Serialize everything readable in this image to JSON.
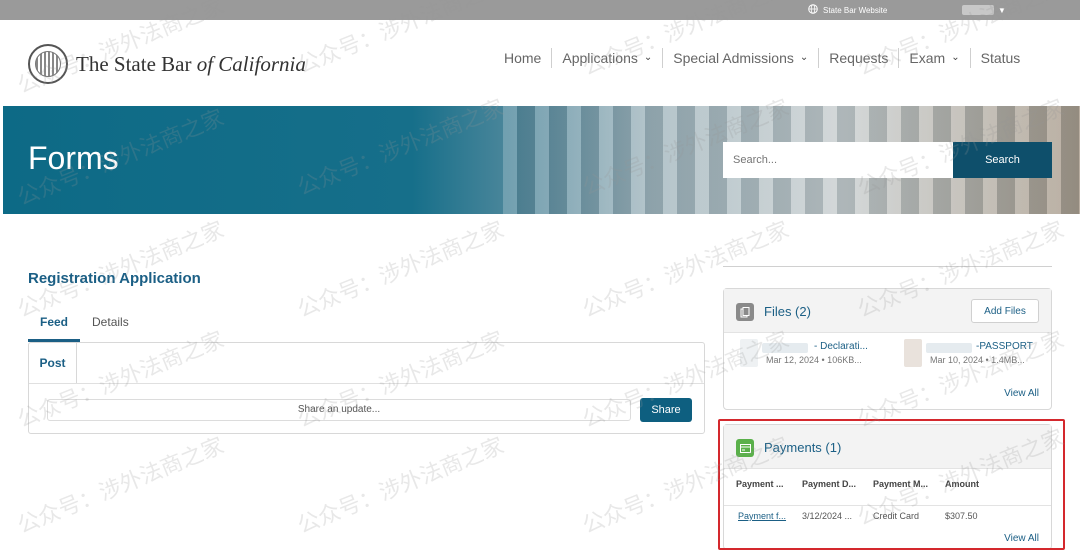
{
  "topbar": {
    "external_link": "State Bar Website"
  },
  "logo": {
    "text_main": "The State Bar",
    "text_italic": "of California"
  },
  "nav": [
    {
      "label": "Home",
      "has_menu": false
    },
    {
      "label": "Applications",
      "has_menu": true
    },
    {
      "label": "Special Admissions",
      "has_menu": true
    },
    {
      "label": "Requests",
      "has_menu": false
    },
    {
      "label": "Exam",
      "has_menu": true
    },
    {
      "label": "Status",
      "has_menu": false
    }
  ],
  "hero": {
    "title": "Forms",
    "search_placeholder": "Search...",
    "search_button": "Search"
  },
  "registration": {
    "title": "Registration Application",
    "tabs": [
      "Feed",
      "Details"
    ],
    "post_tab": "Post",
    "share_placeholder": "Share an update...",
    "share_button": "Share"
  },
  "files": {
    "title": "Files (2)",
    "add_button": "Add Files",
    "items": [
      {
        "name": "- Declarati...",
        "meta": "Mar 12, 2024 • 106KB..."
      },
      {
        "name": "-PASSPORT",
        "meta": "Mar 10, 2024 • 1.4MB..."
      }
    ],
    "view_all": "View All"
  },
  "payments": {
    "title": "Payments (1)",
    "columns": [
      "Payment ...",
      "Payment D...",
      "Payment M...",
      "Amount"
    ],
    "rows": [
      {
        "name": "Payment f...",
        "date": "3/12/2024 ...",
        "method": "Credit Card",
        "amount": "$307.50"
      }
    ],
    "view_all": "View All"
  },
  "watermark": {
    "text": "公众号：涉外法商之家"
  },
  "colors": {
    "accent": "#1b5f85",
    "hero": "#0d6a86",
    "button": "#0e4f6b",
    "highlight": "#d4282d"
  }
}
